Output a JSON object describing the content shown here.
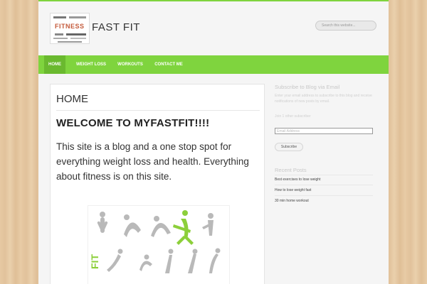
{
  "site": {
    "title": "FAST FIT",
    "logo_word": "FITNESS"
  },
  "search": {
    "placeholder": "Search this website..."
  },
  "nav": {
    "items": [
      "HOME",
      "WEIGHT LOSS",
      "WORKOUTS",
      "CONTACT ME"
    ],
    "active": "HOME"
  },
  "content": {
    "title": "HOME",
    "welcome": "WELCOME TO MYFASTFIT!!!!",
    "intro": "This site is a blog and a one stop spot for everything weight loss and health. Everything about fitness is on this site.",
    "image_side_text": "FIT"
  },
  "sidebar": {
    "subscribe_heading": "Subscribe to Blog via Email",
    "subscribe_text": "Enter your email address to subscribe to this blog and receive notifications of new posts by email.",
    "subscribers_text": "Join 1 other subscriber",
    "email_placeholder": "Email Address",
    "subscribe_button": "Subscribe",
    "recent_heading": "Recent Posts",
    "recent_posts": [
      "Best exercises to lose weight",
      "How to lose weight fast",
      "30 min home workout"
    ]
  },
  "colors": {
    "accent_green": "#7fd43e",
    "figure_gray": "#b9b9b9",
    "figure_green": "#8ccf3a"
  }
}
